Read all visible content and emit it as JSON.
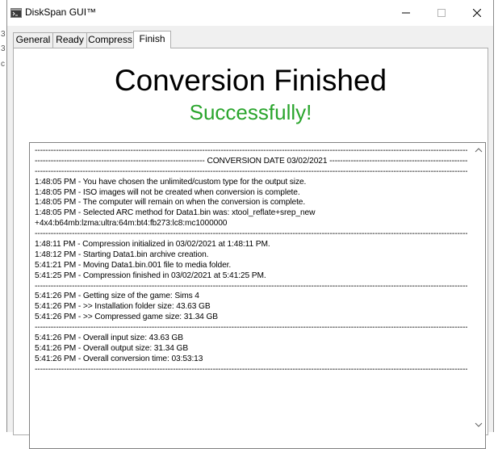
{
  "window": {
    "title": "DiskSpan GUI™",
    "icons": {
      "app": "terminal-icon",
      "minimize": "minimize-icon",
      "maximize": "maximize-icon",
      "close": "close-icon"
    }
  },
  "background_fragments": [
    "3",
    "3",
    "c"
  ],
  "tabs": [
    {
      "label": "General",
      "active": false
    },
    {
      "label": "Ready",
      "active": false
    },
    {
      "label": "Compress",
      "active": false
    },
    {
      "label": "Finish",
      "active": true
    }
  ],
  "finish": {
    "heading": "Conversion Finished",
    "subheading": "Successfully!",
    "subheading_color": "#2aa52d"
  },
  "log": {
    "lines": [
      "------------------------------------------------------------------------------------------------------------------------------------------------------------------------------------------",
      "---------------------------------------------------------------- CONVERSION DATE 03/02/2021 -----------------------------------------------------------",
      "------------------------------------------------------------------------------------------------------------------------------------------------------------------------------------------",
      "1:48:05 PM - You have chosen the unlimited/custom type for the output size.",
      "1:48:05 PM - ISO images will not be created when conversion is complete.",
      "1:48:05 PM - The computer will remain on when the conversion is complete.",
      "1:48:05 PM - Selected ARC method for Data1.bin was: xtool_reflate+srep_new",
      "+4x4:b64mb:lzma:ultra:64m:bt4:fb273:lc8:mc1000000",
      "------------------------------------------------------------------------------------------------------------------------------------------------------------------------------------------",
      "1:48:11 PM - Compression initialized in 03/02/2021 at 1:48:11 PM.",
      "1:48:12 PM - Starting Data1.bin archive creation.",
      "5:41:21 PM - Moving Data1.bin.001 file to media folder.",
      "5:41:25 PM - Compression finished in 03/02/2021 at 5:41:25 PM.",
      "------------------------------------------------------------------------------------------------------------------------------------------------------------------------------------------",
      "5:41:26 PM - Getting size of the game: Sims 4",
      "5:41:26 PM - >> Installation folder size: 43.63 GB",
      "5:41:26 PM - >> Compressed game size: 31.34 GB",
      "------------------------------------------------------------------------------------------------------------------------------------------------------------------------------------------",
      "5:41:26 PM - Overall input size: 43.63 GB",
      "5:41:26 PM - Overall output size: 31.34 GB",
      "5:41:26 PM - Overall conversion time: 03:53:13",
      "------------------------------------------------------------------------------------------------------------------------------------------------------------------------------------------"
    ]
  },
  "scrollbar": {
    "icons": {
      "up": "scroll-up-arrow-icon",
      "down": "scroll-down-arrow-icon"
    }
  }
}
